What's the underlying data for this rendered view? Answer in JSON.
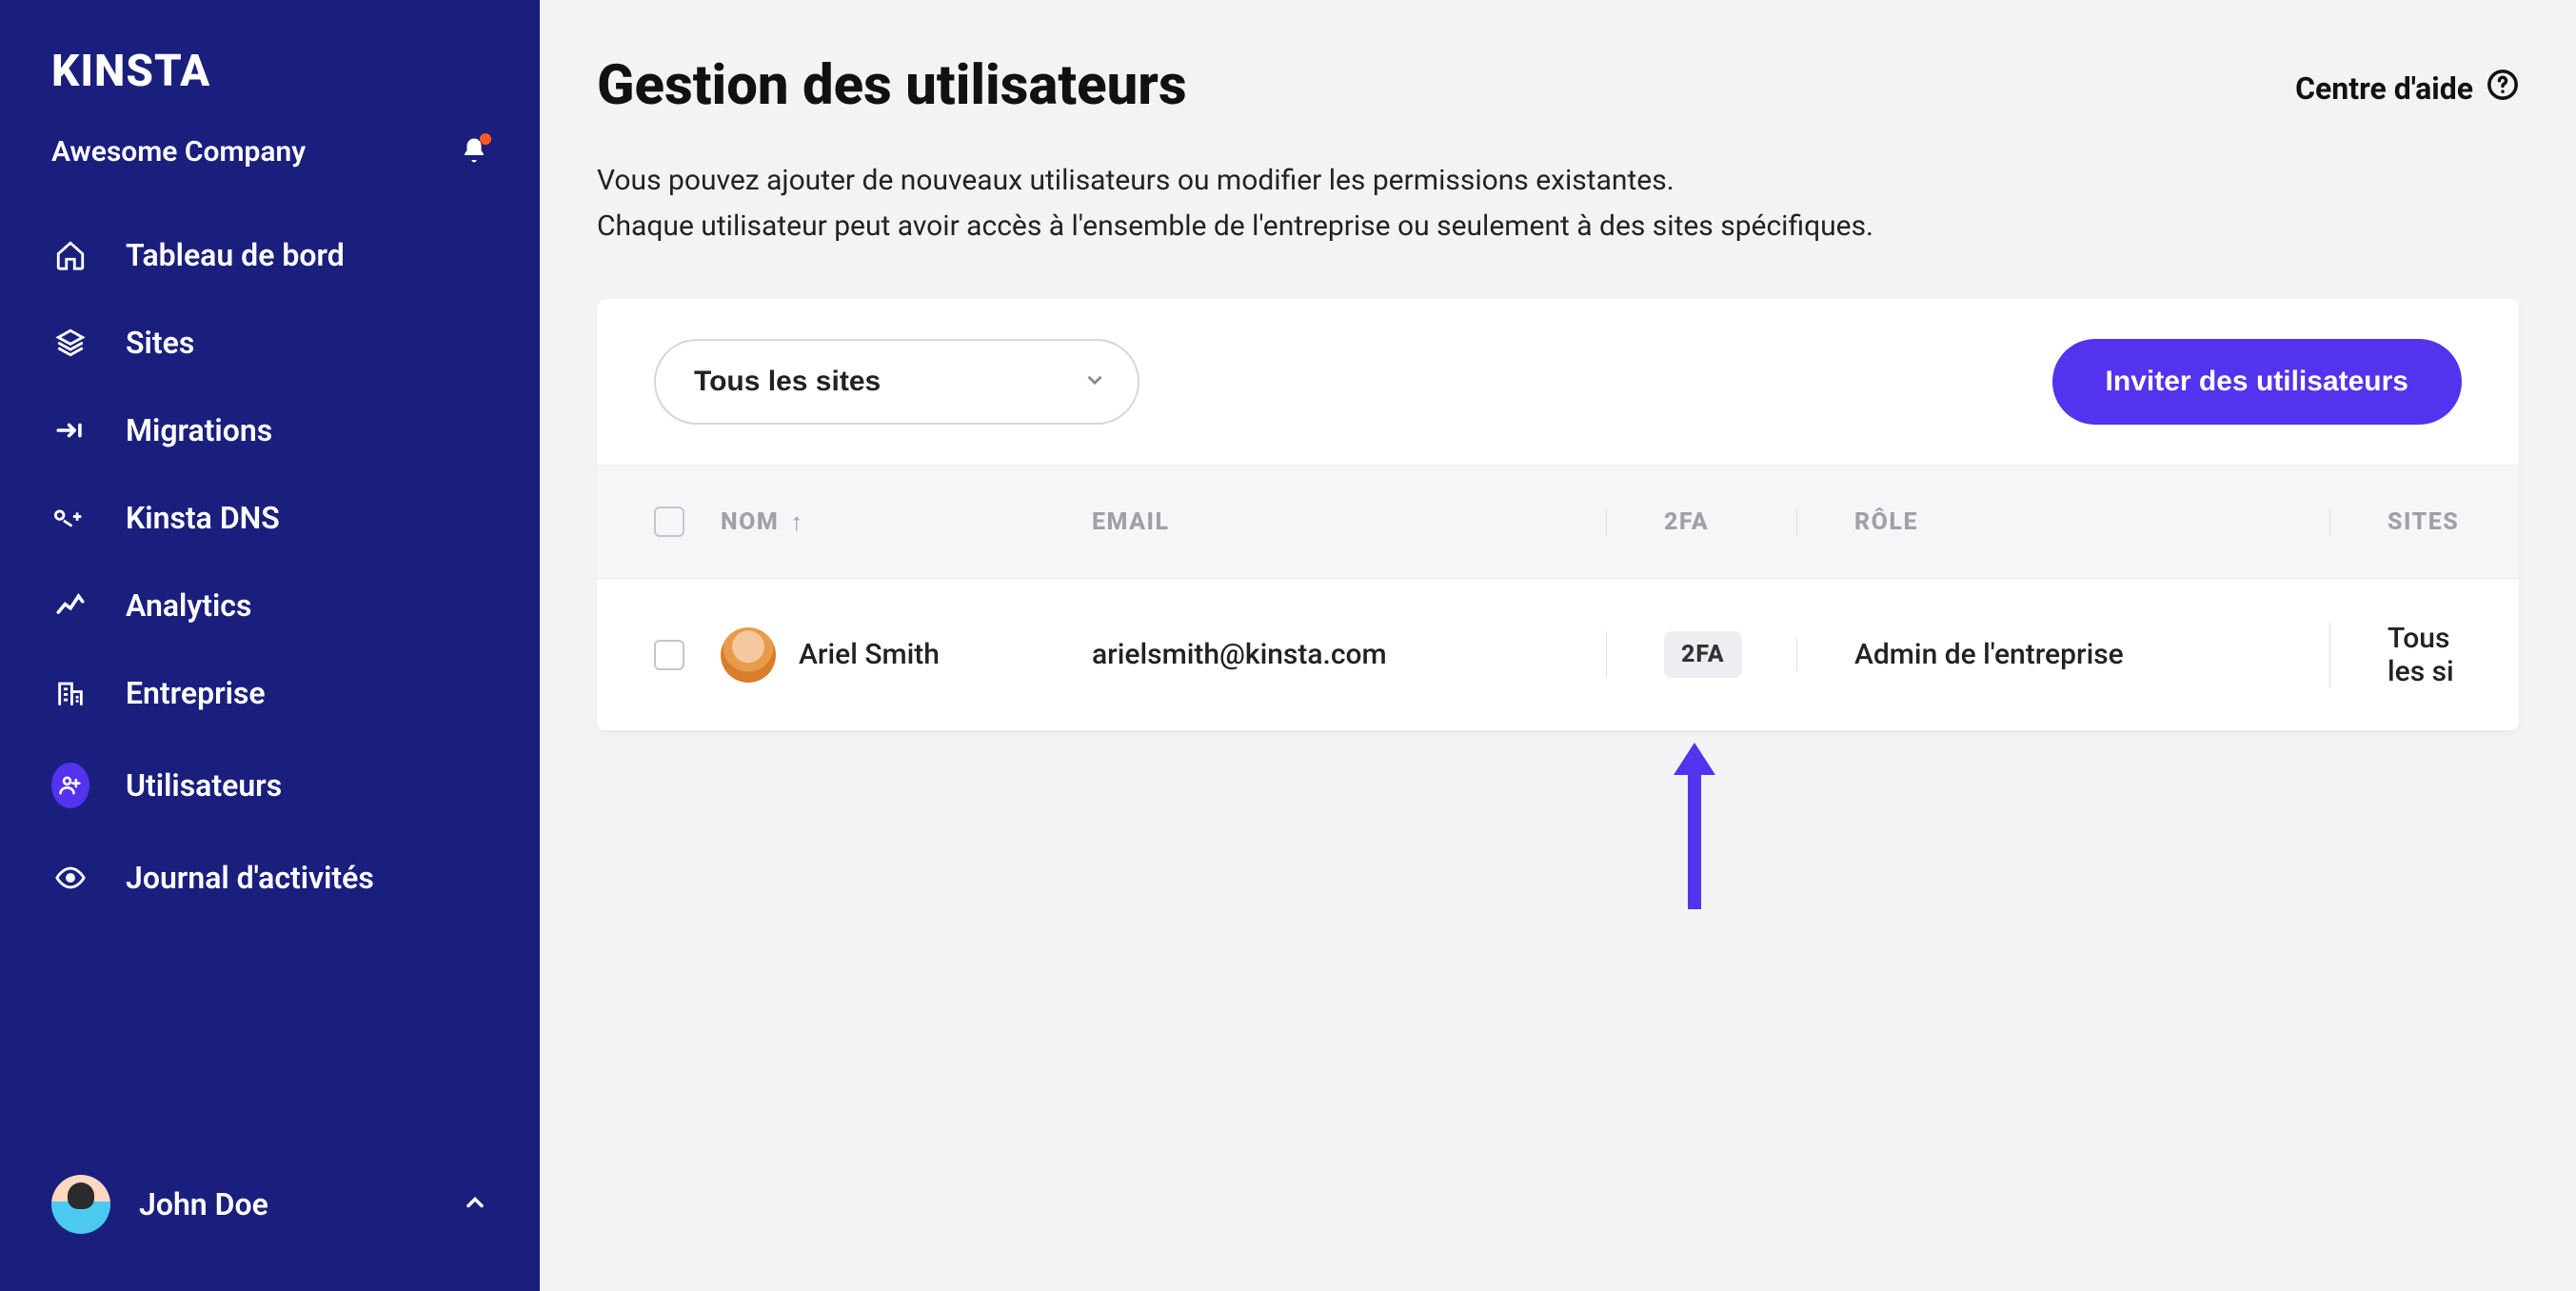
{
  "brand": {
    "logo": "KINSTA"
  },
  "company": {
    "name": "Awesome Company"
  },
  "sidebar": {
    "items": [
      {
        "label": "Tableau de bord"
      },
      {
        "label": "Sites"
      },
      {
        "label": "Migrations"
      },
      {
        "label": "Kinsta DNS"
      },
      {
        "label": "Analytics"
      },
      {
        "label": "Entreprise"
      },
      {
        "label": "Utilisateurs"
      },
      {
        "label": "Journal d'activités"
      }
    ],
    "active_index": 6
  },
  "current_user": {
    "name": "John Doe"
  },
  "header": {
    "title": "Gestion des utilisateurs",
    "help_label": "Centre d'aide"
  },
  "description": {
    "line1": "Vous pouvez ajouter de nouveaux utilisateurs ou modifier les permissions existantes.",
    "line2": "Chaque utilisateur peut avoir accès à l'ensemble de l'entreprise ou seulement à des sites spécifiques."
  },
  "toolbar": {
    "filter_selected": "Tous les sites",
    "invite_label": "Inviter des utilisateurs"
  },
  "table": {
    "columns": {
      "name": "NOM",
      "email": "EMAIL",
      "twofa": "2FA",
      "role": "RÔLE",
      "sites": "SITES"
    },
    "sort_indicator": "↑",
    "rows": [
      {
        "name": "Ariel Smith",
        "email": "arielsmith@kinsta.com",
        "twofa_badge": "2FA",
        "role": "Admin de l'entreprise",
        "sites": "Tous les si"
      }
    ]
  },
  "colors": {
    "sidebar_bg": "#1a1f7e",
    "accent": "#5333ed",
    "notification_dot": "#ff5a1f"
  }
}
